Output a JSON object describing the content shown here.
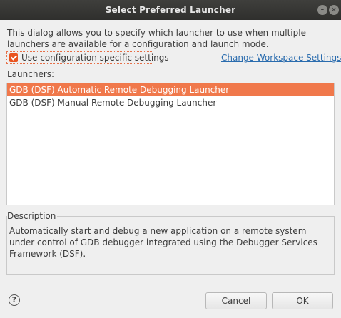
{
  "window": {
    "title": "Select Preferred Launcher",
    "minimize_glyph": "–",
    "close_glyph": "×"
  },
  "intro_text": "This dialog allows you to specify which launcher to use when multiple launchers are available for a configuration and launch mode.",
  "config_checkbox": {
    "label": "Use configuration specific settings",
    "checked": true
  },
  "workspace_link": "Change Workspace Settings...",
  "launchers": {
    "label": "Launchers:",
    "items": [
      {
        "label": "GDB (DSF) Automatic Remote Debugging Launcher",
        "selected": true
      },
      {
        "label": "GDB (DSF) Manual Remote Debugging Launcher",
        "selected": false
      }
    ]
  },
  "description": {
    "title": "Description",
    "text": "Automatically start and debug a new application on a remote system under control of GDB debugger integrated using the Debugger Services Framework (DSF)."
  },
  "buttons": {
    "help": "?",
    "cancel": "Cancel",
    "ok": "OK"
  },
  "colors": {
    "accent": "#e95420",
    "selection": "#f0784b",
    "link": "#2a6cae",
    "titlebar": "#353533"
  }
}
